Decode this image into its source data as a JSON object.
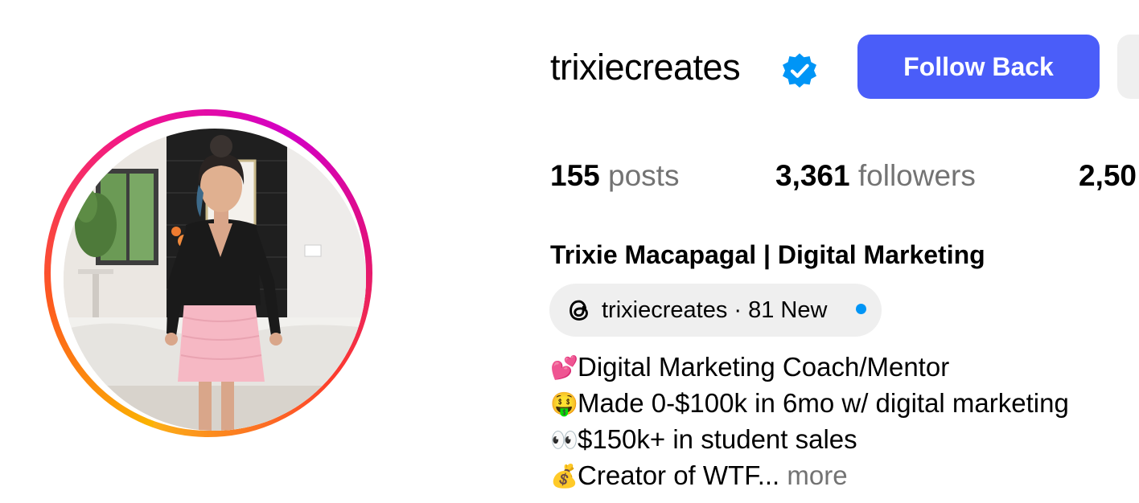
{
  "profile": {
    "username": "trixiecreates",
    "verified_icon": "verified-badge-icon",
    "follow_button_label": "Follow Back",
    "full_name": "Trixie Macapagal | Digital Marketing"
  },
  "stats": {
    "posts_count": "155",
    "posts_label": " posts",
    "followers_count": "3,361",
    "followers_label": " followers",
    "following_count": "2,50"
  },
  "threads": {
    "icon": "threads-icon",
    "text": "trixiecreates · 81 New"
  },
  "bio": {
    "lines": [
      {
        "emoji": "💕",
        "text": "Digital Marketing Coach/Mentor"
      },
      {
        "emoji": "🤑",
        "text": "Made 0-$100k in 6mo w/ digital marketing"
      },
      {
        "emoji": "👀",
        "text": "$150k+ in student sales"
      },
      {
        "emoji": "💰",
        "text": "Creator of WTF..."
      }
    ],
    "more_label": " more"
  },
  "colors": {
    "primary_button": "#4a5df9",
    "verified": "#0095f6",
    "secondary_text": "#737373",
    "pill_bg": "#efefef"
  }
}
